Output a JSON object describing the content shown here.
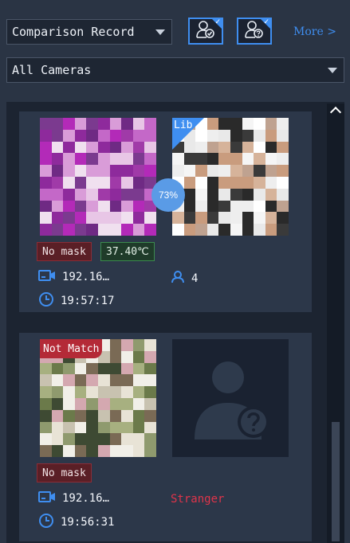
{
  "toolbar": {
    "record_select": "Comparison Record",
    "camera_select": "All Cameras",
    "more_label": "More >"
  },
  "records": [
    {
      "mask_label": "No mask",
      "temperature": "37.40℃",
      "library_tag": "Lib",
      "similarity": "73%",
      "camera": "192.16…",
      "time": "19:57:17",
      "match_count": "4"
    },
    {
      "match_tag": "Not Match",
      "mask_label": "No mask",
      "camera": "192.16…",
      "time": "19:56:31",
      "result": "Stranger"
    }
  ],
  "colors": {
    "accent": "#3f8ef0",
    "alert": "#e0344a",
    "temperature_ok": "#3b8b4e"
  }
}
